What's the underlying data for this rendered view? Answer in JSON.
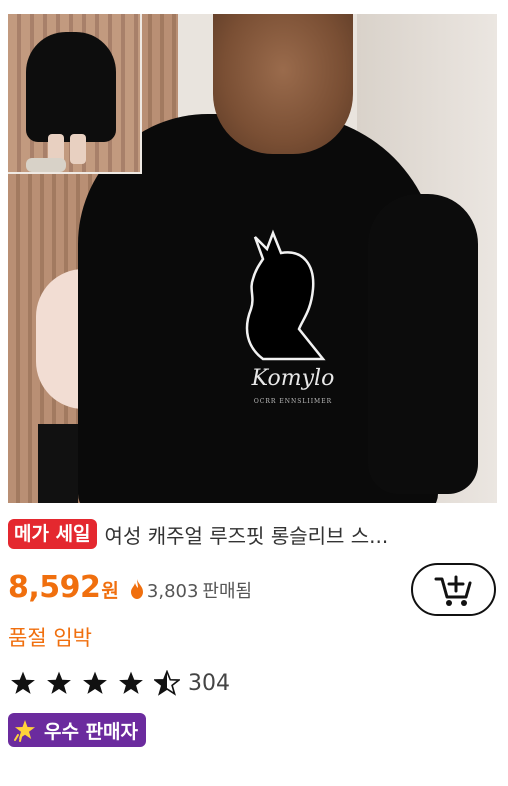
{
  "product": {
    "image_brand_text": "Komylo",
    "image_brand_subtext": "OCRR ENNSLIIMER",
    "promo_badge": "메가 세일",
    "title": "여성 캐주얼 루즈핏 롱슬리브 스...",
    "price": "8,592",
    "currency": "원",
    "sold_count": "3,803",
    "sold_label": "판매됨",
    "low_stock": "품절 임박",
    "rating": 4.5,
    "review_count": "304",
    "seller_badge": "우수 판매자"
  },
  "icons": {
    "fire": "fire-icon",
    "cart": "add-to-cart-icon",
    "star": "star-icon",
    "seller": "sparkle-star-icon"
  },
  "colors": {
    "accent": "#f06f0e",
    "promo": "#e4282f",
    "seller_badge": "#6b2b9e"
  }
}
